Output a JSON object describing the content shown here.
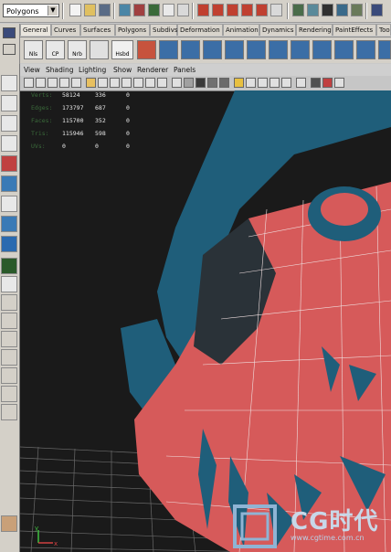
{
  "app": {
    "mode_select": "Polygons"
  },
  "shelf_tabs": [
    "General",
    "Curves",
    "Surfaces",
    "Polygons",
    "Subdivs",
    "Deformation",
    "Animation",
    "Dynamics",
    "Rendering",
    "PaintEffects",
    "Toon"
  ],
  "shelf_icon_labels": [
    "Nls",
    "CP",
    "Nrb",
    "",
    "Hsbd"
  ],
  "panel_menu": [
    "View",
    "Shading",
    "Lighting",
    "Show",
    "Renderer",
    "Panels"
  ],
  "hud": {
    "rows": [
      {
        "label": "Verts:",
        "c1": "58124",
        "c2": "336",
        "c3": "0"
      },
      {
        "label": "Edges:",
        "c1": "173797",
        "c2": "687",
        "c3": "0"
      },
      {
        "label": "Faces:",
        "c1": "115700",
        "c2": "352",
        "c3": "0"
      },
      {
        "label": "Tris:",
        "c1": "115946",
        "c2": "598",
        "c3": "0"
      },
      {
        "label": "UVs:",
        "c1": "0",
        "c2": "0",
        "c3": "0"
      }
    ]
  },
  "axis": {
    "y": "y",
    "x": "x"
  },
  "watermark": {
    "brand": "CG时代",
    "url": "www.cgtime.com.cn"
  },
  "colors": {
    "mesh_red": "#d65a5a",
    "mesh_blue": "#1f5e7a",
    "bg": "#1a1a1a",
    "ui": "#d4d0c8"
  }
}
